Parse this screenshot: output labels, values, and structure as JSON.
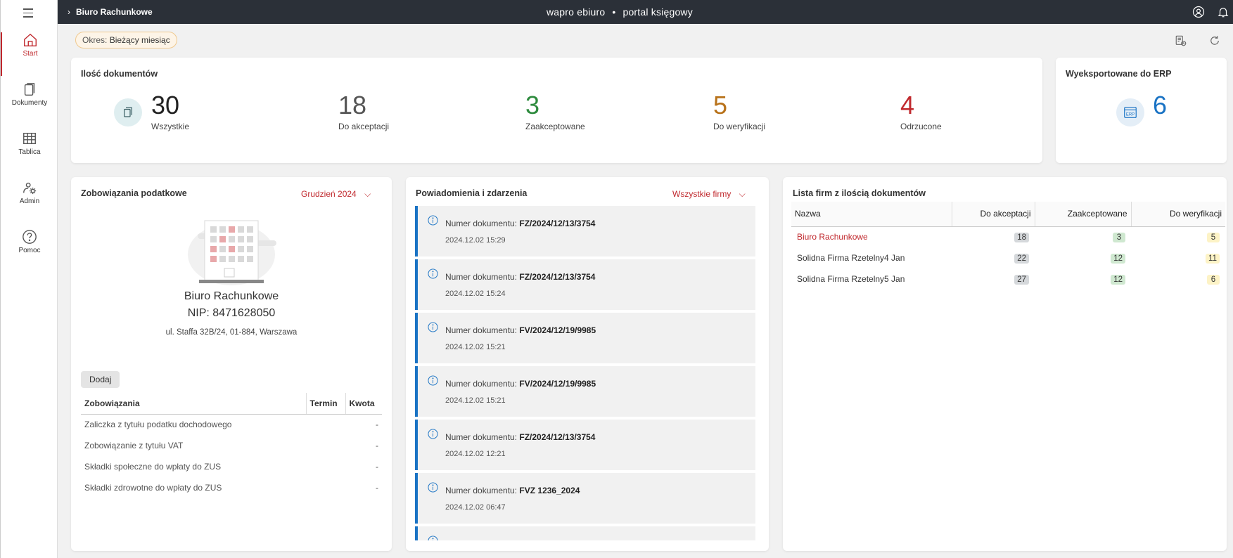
{
  "app": {
    "breadcrumb": "Biuro Rachunkowe",
    "brand_left": "wapro ebiuro",
    "brand_right": "portal księgowy",
    "accent_color": "#c0282d",
    "topbar_color": "#2b3038"
  },
  "sidebar": {
    "items": [
      {
        "label": "Start",
        "icon": "home-icon",
        "active": true
      },
      {
        "label": "Dokumenty",
        "icon": "documents-icon",
        "active": false
      },
      {
        "label": "Tablica",
        "icon": "table-icon",
        "active": false
      },
      {
        "label": "Admin",
        "icon": "admin-gear-icon",
        "active": false
      },
      {
        "label": "Pomoc",
        "icon": "help-icon",
        "active": false
      }
    ]
  },
  "period": {
    "label": "Okres:",
    "value": "Bieżący miesiąc"
  },
  "documents": {
    "title": "Ilość dokumentów",
    "stats": [
      {
        "value": "30",
        "label": "Wszystkie",
        "color": "#222222"
      },
      {
        "value": "18",
        "label": "Do akceptacji",
        "color": "#555555"
      },
      {
        "value": "3",
        "label": "Zaakceptowane",
        "color": "#2e8b3e"
      },
      {
        "value": "5",
        "label": "Do weryfikacji",
        "color": "#b8721a"
      },
      {
        "value": "4",
        "label": "Odrzucone",
        "color": "#c0282d"
      }
    ]
  },
  "erp": {
    "title": "Wyeksportowane do ERP",
    "value": "6",
    "icon_text": "ERP",
    "color": "#1a73c4"
  },
  "tax": {
    "title": "Zobowiązania podatkowe",
    "month": "Grudzień 2024",
    "company_name": "Biuro Rachunkowe",
    "company_nip": "NIP: 8471628050",
    "company_address": "ul. Staffa 32B/24, 01-884, Warszawa",
    "add_button": "Dodaj",
    "columns": [
      "Zobowiązania",
      "Termin",
      "Kwota"
    ],
    "rows": [
      {
        "name": "Zaliczka z tytułu podatku dochodowego",
        "term": "",
        "amount": "-"
      },
      {
        "name": "Zobowiązanie z tytułu VAT",
        "term": "",
        "amount": "-"
      },
      {
        "name": "Składki społeczne do wpłaty do ZUS",
        "term": "",
        "amount": "-"
      },
      {
        "name": "Składki zdrowotne do wpłaty do ZUS",
        "term": "",
        "amount": "-"
      }
    ]
  },
  "notifications": {
    "title": "Powiadomienia i zdarzenia",
    "filter": "Wszystkie firmy",
    "doc_label": "Numer dokumentu:",
    "items": [
      {
        "number": "FZ/2024/12/13/3754",
        "date": "2024.12.02 15:29"
      },
      {
        "number": "FZ/2024/12/13/3754",
        "date": "2024.12.02 15:24"
      },
      {
        "number": "FV/2024/12/19/9985",
        "date": "2024.12.02 15:21"
      },
      {
        "number": "FV/2024/12/19/9985",
        "date": "2024.12.02 15:21"
      },
      {
        "number": "FZ/2024/12/13/3754",
        "date": "2024.12.02 12:21"
      },
      {
        "number": "FVZ 1236_2024",
        "date": "2024.12.02 06:47"
      }
    ]
  },
  "firms": {
    "title": "Lista firm z ilością dokumentów",
    "columns": [
      "Nazwa",
      "Do akceptacji",
      "Zaakceptowane",
      "Do weryfikacji"
    ],
    "rows": [
      {
        "name": "Biuro Rachunkowe",
        "to_accept": "18",
        "accepted": "3",
        "to_verify": "5"
      },
      {
        "name": "Solidna Firma Rzetelny4 Jan",
        "to_accept": "22",
        "accepted": "12",
        "to_verify": "11"
      },
      {
        "name": "Solidna Firma Rzetelny5 Jan",
        "to_accept": "27",
        "accepted": "12",
        "to_verify": "6"
      }
    ]
  }
}
